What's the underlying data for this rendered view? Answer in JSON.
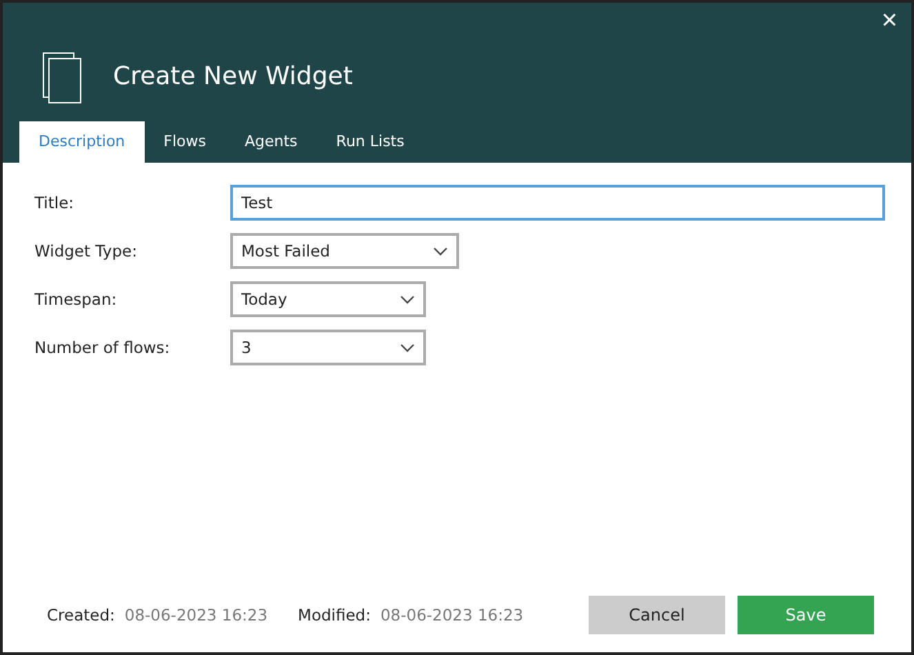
{
  "window": {
    "title": "Create New Widget",
    "close": "×"
  },
  "tabs": [
    {
      "label": "Description",
      "selected": true
    },
    {
      "label": "Flows",
      "selected": false
    },
    {
      "label": "Agents",
      "selected": false
    },
    {
      "label": "Run Lists",
      "selected": false
    }
  ],
  "fields": [
    {
      "kind": "text",
      "label": "Title:",
      "value": "Test",
      "focused": true
    },
    {
      "kind": "select",
      "label": "Widget Type:",
      "value": "Most Failed"
    },
    {
      "kind": "select",
      "label": "Timespan:",
      "value": "Today"
    },
    {
      "kind": "select",
      "label": "Number of flows:",
      "value": "3"
    }
  ],
  "footer": {
    "created_label": "Created:",
    "created": "08-06-2023 16:23",
    "modified_label": "Modified:",
    "modified": "08-06-2023 16:23"
  },
  "buttons": [
    {
      "kind": "secondary",
      "label": "Cancel"
    },
    {
      "kind": "primary",
      "label": "Save"
    }
  ]
}
